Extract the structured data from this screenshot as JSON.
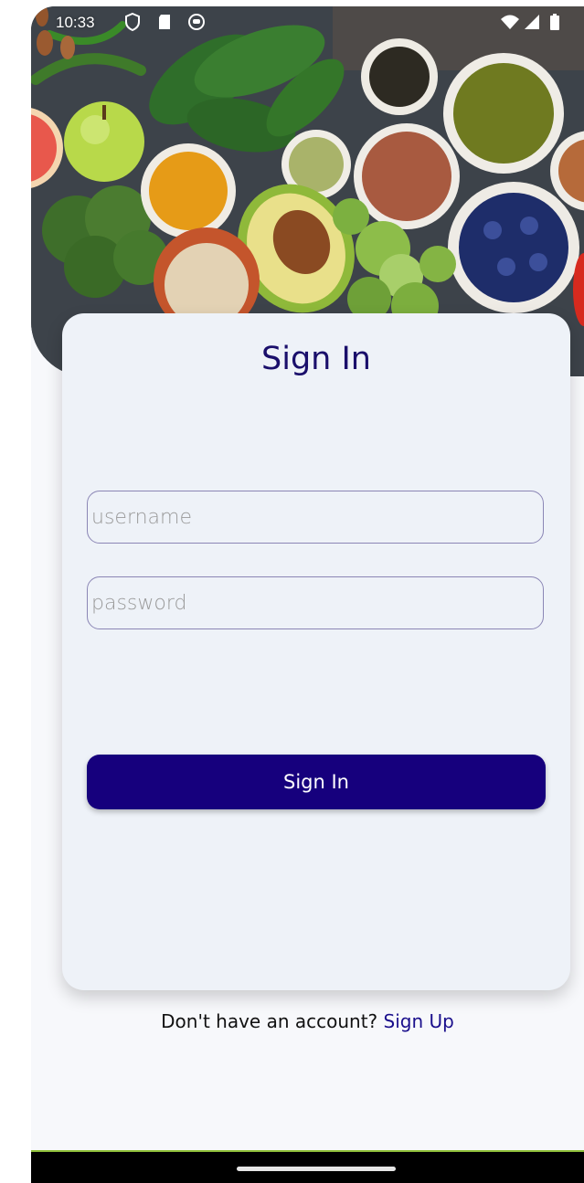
{
  "status_bar": {
    "time": "10:33",
    "left_icons": [
      "shield-icon",
      "sd-card-icon",
      "circle-app-icon"
    ],
    "right_icons": [
      "wifi-icon",
      "signal-icon",
      "battery-icon"
    ]
  },
  "hero": {
    "description_icon": "food-ingredients-image"
  },
  "card": {
    "title": "Sign In",
    "username_placeholder": "username",
    "username_value": "",
    "password_placeholder": "password",
    "password_value": "",
    "signin_label": "Sign In"
  },
  "footer": {
    "prompt": "Don't have an account?",
    "signup_label": "Sign Up"
  },
  "colors": {
    "accent": "#16007d",
    "title": "#1a0f6b",
    "card_bg": "#eef2f8",
    "page_bg": "#f7f8fb"
  }
}
